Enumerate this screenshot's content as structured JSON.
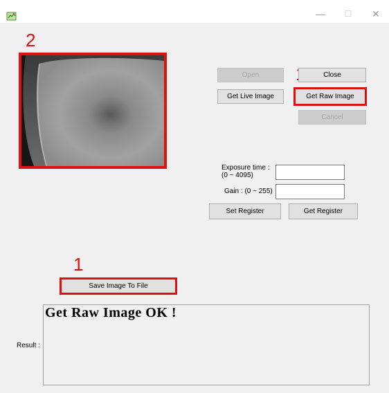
{
  "window": {
    "minimize_glyph": "—",
    "maximize_glyph": "☐",
    "close_glyph": "✕"
  },
  "annotations": {
    "preview_marker": "2",
    "get_raw_marker": "1",
    "save_marker": "1",
    "color": "#e01010"
  },
  "buttons": {
    "open": "Open",
    "close": "Close",
    "get_live": "Get Live Image",
    "get_raw": "Get Raw Image",
    "cancel": "Cancel",
    "set_register": "Set Register",
    "get_register": "Get Register",
    "save_image": "Save Image To File"
  },
  "fields": {
    "exposure_label_line1": "Exposure time :",
    "exposure_label_line2": "(0 ~ 4095)",
    "exposure_value": "",
    "gain_label": "Gain : (0 ~ 255)",
    "gain_value": ""
  },
  "result": {
    "label": "Result :",
    "text": "Get Raw Image OK !"
  }
}
